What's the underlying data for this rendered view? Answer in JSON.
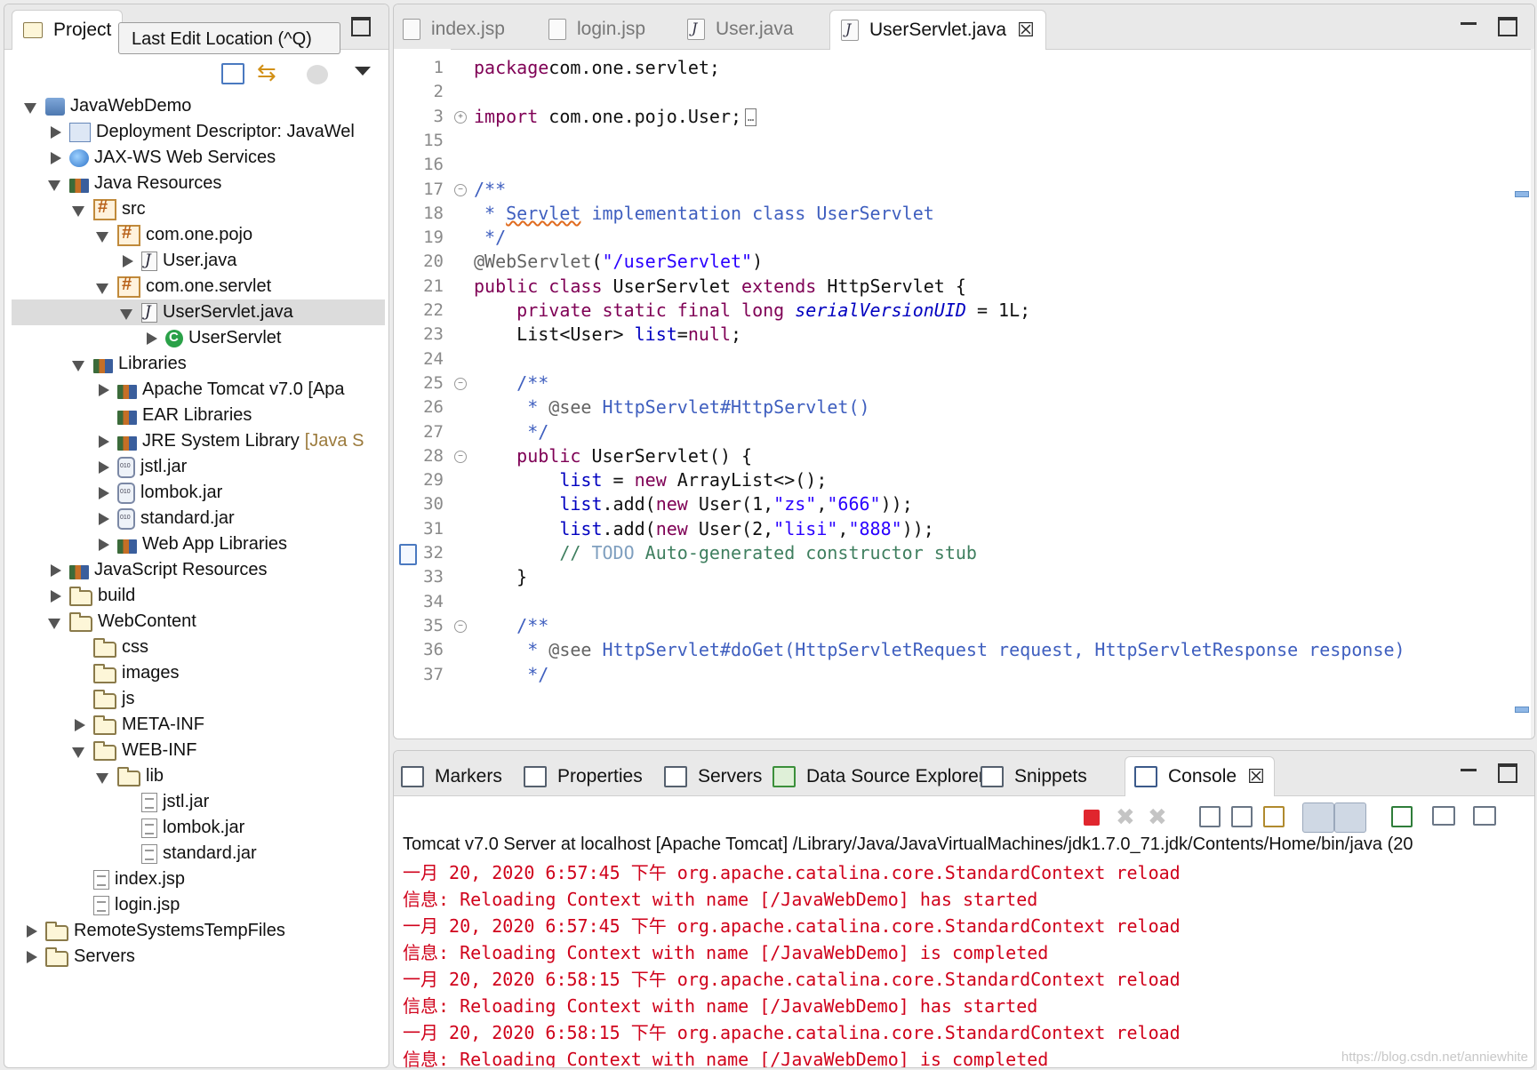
{
  "project_view": {
    "tab_label": "Project",
    "tooltip": "Last Edit Location (^Q)",
    "tree": [
      {
        "label": "JavaWebDemo",
        "indent": 0,
        "twisty": "open",
        "icon": "project"
      },
      {
        "label": "Deployment Descriptor: JavaWel",
        "indent": 1,
        "twisty": "closed",
        "icon": "dd"
      },
      {
        "label": "JAX-WS Web Services",
        "indent": 1,
        "twisty": "closed",
        "icon": "globe"
      },
      {
        "label": "Java Resources",
        "indent": 1,
        "twisty": "open",
        "icon": "lib"
      },
      {
        "label": "src",
        "indent": 2,
        "twisty": "open",
        "icon": "package"
      },
      {
        "label": "com.one.pojo",
        "indent": 3,
        "twisty": "open",
        "icon": "package"
      },
      {
        "label": "User.java",
        "indent": 4,
        "twisty": "closed",
        "icon": "jfile"
      },
      {
        "label": "com.one.servlet",
        "indent": 3,
        "twisty": "open",
        "icon": "package"
      },
      {
        "label": "UserServlet.java",
        "indent": 4,
        "twisty": "open",
        "icon": "jfile",
        "selected": true
      },
      {
        "label": "UserServlet",
        "indent": 5,
        "twisty": "closed",
        "icon": "class"
      },
      {
        "label": "Libraries",
        "indent": 2,
        "twisty": "open",
        "icon": "lib"
      },
      {
        "label": "Apache Tomcat v7.0 [Apa",
        "indent": 3,
        "twisty": "closed",
        "icon": "lib"
      },
      {
        "label": "EAR Libraries",
        "indent": 3,
        "twisty": "none",
        "icon": "lib"
      },
      {
        "label": "JRE System Library",
        "decoration": "[Java S",
        "indent": 3,
        "twisty": "closed",
        "icon": "lib"
      },
      {
        "label": "jstl.jar",
        "indent": 3,
        "twisty": "closed",
        "icon": "jar"
      },
      {
        "label": "lombok.jar",
        "indent": 3,
        "twisty": "closed",
        "icon": "jar"
      },
      {
        "label": "standard.jar",
        "indent": 3,
        "twisty": "closed",
        "icon": "jar"
      },
      {
        "label": "Web App Libraries",
        "indent": 3,
        "twisty": "closed",
        "icon": "lib"
      },
      {
        "label": "JavaScript Resources",
        "indent": 1,
        "twisty": "closed",
        "icon": "lib"
      },
      {
        "label": "build",
        "indent": 1,
        "twisty": "closed",
        "icon": "folder"
      },
      {
        "label": "WebContent",
        "indent": 1,
        "twisty": "open",
        "icon": "folder"
      },
      {
        "label": "css",
        "indent": 2,
        "twisty": "none",
        "icon": "folder"
      },
      {
        "label": "images",
        "indent": 2,
        "twisty": "none",
        "icon": "folder"
      },
      {
        "label": "js",
        "indent": 2,
        "twisty": "none",
        "icon": "folder"
      },
      {
        "label": "META-INF",
        "indent": 2,
        "twisty": "closed",
        "icon": "folder"
      },
      {
        "label": "WEB-INF",
        "indent": 2,
        "twisty": "open",
        "icon": "folder"
      },
      {
        "label": "lib",
        "indent": 3,
        "twisty": "open",
        "icon": "folder"
      },
      {
        "label": "jstl.jar",
        "indent": 4,
        "twisty": "none",
        "icon": "jsfile"
      },
      {
        "label": "lombok.jar",
        "indent": 4,
        "twisty": "none",
        "icon": "jsfile"
      },
      {
        "label": "standard.jar",
        "indent": 4,
        "twisty": "none",
        "icon": "jsfile"
      },
      {
        "label": "index.jsp",
        "indent": 2,
        "twisty": "none",
        "icon": "jsfile"
      },
      {
        "label": "login.jsp",
        "indent": 2,
        "twisty": "none",
        "icon": "jsfile"
      },
      {
        "label": "RemoteSystemsTempFiles",
        "indent": 0,
        "twisty": "closed",
        "icon": "folder"
      },
      {
        "label": "Servers",
        "indent": 0,
        "twisty": "closed",
        "icon": "folder"
      }
    ]
  },
  "editor": {
    "tabs": [
      {
        "label": "index.jsp",
        "icon": "jsp"
      },
      {
        "label": "login.jsp",
        "icon": "jsp"
      },
      {
        "label": "User.java",
        "icon": "java"
      },
      {
        "label": "UserServlet.java",
        "icon": "java",
        "active": true
      }
    ],
    "lines": [
      {
        "num": "1",
        "tokens": [
          [
            "kw",
            "package"
          ],
          [
            "",
            "com.one.servlet;"
          ]
        ]
      },
      {
        "num": "2",
        "tokens": []
      },
      {
        "num": "3",
        "fold": "+",
        "tokens": [
          [
            "kw",
            "import"
          ],
          [
            "",
            " com.one.pojo.User;"
          ],
          [
            "box",
            "…"
          ]
        ]
      },
      {
        "num": "15",
        "tokens": []
      },
      {
        "num": "16",
        "tokens": []
      },
      {
        "num": "17",
        "fold": "-",
        "tokens": [
          [
            "cm",
            "/**"
          ]
        ]
      },
      {
        "num": "18",
        "tokens": [
          [
            "cm",
            " * "
          ],
          [
            "cm squiggle",
            "Servlet"
          ],
          [
            "cm",
            " implementation class UserServlet"
          ]
        ]
      },
      {
        "num": "19",
        "tokens": [
          [
            "cm",
            " */"
          ]
        ]
      },
      {
        "num": "20",
        "tokens": [
          [
            "ann",
            "@WebServlet"
          ],
          [
            "",
            "("
          ],
          [
            "str",
            "\"/userServlet\""
          ],
          [
            "",
            ")"
          ]
        ]
      },
      {
        "num": "21",
        "tokens": [
          [
            "kw",
            "public class"
          ],
          [
            "",
            " UserServlet "
          ],
          [
            "kw",
            "extends"
          ],
          [
            "",
            " HttpServlet {"
          ]
        ]
      },
      {
        "num": "22",
        "tokens": [
          [
            "",
            "    "
          ],
          [
            "kw",
            "private static final long"
          ],
          [
            "",
            " "
          ],
          [
            "fld ital",
            "serialVersionUID"
          ],
          [
            "",
            " = 1L;"
          ]
        ]
      },
      {
        "num": "23",
        "tokens": [
          [
            "",
            "    List<User> "
          ],
          [
            "fld",
            "list"
          ],
          [
            "",
            "="
          ],
          [
            "kw",
            "null"
          ],
          [
            "",
            ";"
          ]
        ]
      },
      {
        "num": "24",
        "tokens": []
      },
      {
        "num": "25",
        "fold": "-",
        "tokens": [
          [
            "",
            "    "
          ],
          [
            "cm",
            "/**"
          ]
        ]
      },
      {
        "num": "26",
        "tokens": [
          [
            "",
            "    "
          ],
          [
            "cm",
            " * "
          ],
          [
            "ann",
            "@see"
          ],
          [
            "cm",
            " HttpServlet#HttpServlet()"
          ]
        ]
      },
      {
        "num": "27",
        "tokens": [
          [
            "",
            "    "
          ],
          [
            "cm",
            " */"
          ]
        ]
      },
      {
        "num": "28",
        "fold": "-",
        "tokens": [
          [
            "",
            "    "
          ],
          [
            "kw",
            "public"
          ],
          [
            "",
            " UserServlet() {"
          ]
        ]
      },
      {
        "num": "29",
        "tokens": [
          [
            "",
            "        "
          ],
          [
            "fld",
            "list"
          ],
          [
            "",
            " = "
          ],
          [
            "kw",
            "new"
          ],
          [
            "",
            " ArrayList<>();"
          ]
        ]
      },
      {
        "num": "30",
        "tokens": [
          [
            "",
            "        "
          ],
          [
            "fld",
            "list"
          ],
          [
            "",
            ".add("
          ],
          [
            "kw",
            "new"
          ],
          [
            "",
            " User(1,"
          ],
          [
            "str",
            "\"zs\""
          ],
          [
            "",
            ","
          ],
          [
            "str",
            "\"666\""
          ],
          [
            "",
            "));"
          ]
        ]
      },
      {
        "num": "31",
        "tokens": [
          [
            "",
            "        "
          ],
          [
            "fld",
            "list"
          ],
          [
            "",
            ".add("
          ],
          [
            "kw",
            "new"
          ],
          [
            "",
            " User(2,"
          ],
          [
            "str",
            "\"lisi\""
          ],
          [
            "",
            ","
          ],
          [
            "str",
            "\"888\""
          ],
          [
            "",
            "));"
          ]
        ]
      },
      {
        "num": "32",
        "marker": true,
        "tokens": [
          [
            "",
            "        "
          ],
          [
            "lc",
            "// "
          ],
          [
            "todo",
            "TODO"
          ],
          [
            "lc",
            " Auto-generated constructor stub"
          ]
        ]
      },
      {
        "num": "33",
        "tokens": [
          [
            "",
            "    }"
          ]
        ]
      },
      {
        "num": "34",
        "tokens": []
      },
      {
        "num": "35",
        "fold": "-",
        "tokens": [
          [
            "",
            "    "
          ],
          [
            "cm",
            "/**"
          ]
        ]
      },
      {
        "num": "36",
        "tokens": [
          [
            "",
            "    "
          ],
          [
            "cm",
            " * "
          ],
          [
            "ann",
            "@see"
          ],
          [
            "cm",
            " HttpServlet#doGet(HttpServletRequest request, HttpServletResponse response)"
          ]
        ]
      },
      {
        "num": "37",
        "tokens": [
          [
            "",
            "    "
          ],
          [
            "cm",
            " */"
          ]
        ]
      }
    ]
  },
  "console_view": {
    "tabs": [
      {
        "label": "Markers"
      },
      {
        "label": "Properties"
      },
      {
        "label": "Servers"
      },
      {
        "label": "Data Source Explorer"
      },
      {
        "label": "Snippets"
      },
      {
        "label": "Console",
        "active": true
      }
    ],
    "header": "Tomcat v7.0 Server at localhost [Apache Tomcat] /Library/Java/JavaVirtualMachines/jdk1.7.0_71.jdk/Contents/Home/bin/java (20",
    "lines": [
      "一月 20, 2020 6:57:45 下午 org.apache.catalina.core.StandardContext reload",
      "信息: Reloading Context with name [/JavaWebDemo] has started",
      "一月 20, 2020 6:57:45 下午 org.apache.catalina.core.StandardContext reload",
      "信息: Reloading Context with name [/JavaWebDemo] is completed",
      "一月 20, 2020 6:58:15 下午 org.apache.catalina.core.StandardContext reload",
      "信息: Reloading Context with name [/JavaWebDemo] has started",
      "一月 20, 2020 6:58:15 下午 org.apache.catalina.core.StandardContext reload",
      "信息: Reloading Context with name [/JavaWebDemo] is completed"
    ]
  },
  "watermark": "https://blog.csdn.net/anniewhite",
  "colors": {
    "console_text": "#d0021b",
    "keyword": "#7f0055",
    "javadoc": "#3f5fbf",
    "string": "#2a00ff",
    "field": "#0000c0",
    "line_comment": "#3f7f5f"
  }
}
